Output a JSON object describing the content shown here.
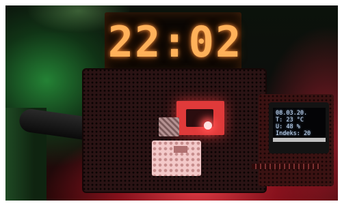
{
  "scene": {
    "clock_display": {
      "time": "22:02"
    },
    "oled_display": {
      "lines": [
        "08.03.20.",
        "T: 23 °C",
        "U: 48 %",
        "Indeks: 20"
      ]
    }
  },
  "colors": {
    "clock_digits": "#ffb15a",
    "oled_text": "#cfe4ff",
    "board_glow": "#e03a3a",
    "left_light": "#2f9a44"
  }
}
